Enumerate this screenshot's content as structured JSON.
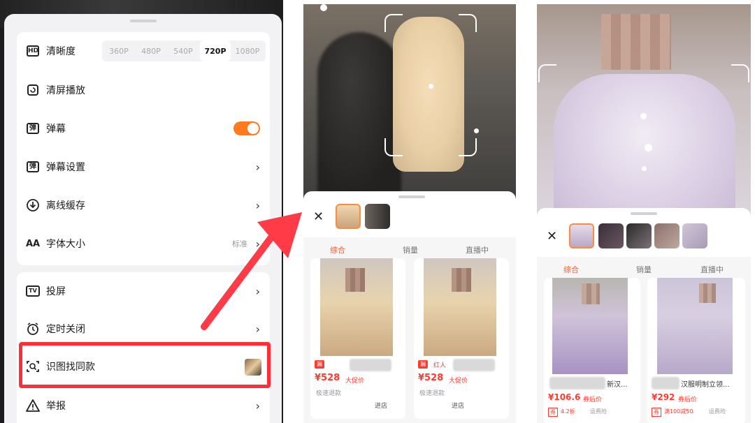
{
  "settings": {
    "quality": {
      "label": "清晰度",
      "options": [
        "360P",
        "480P",
        "540P",
        "720P",
        "1080P"
      ],
      "selected": "720P"
    },
    "items": [
      {
        "label": "清屏播放"
      },
      {
        "label": "弹幕",
        "toggle": true
      },
      {
        "label": "弹幕设置"
      },
      {
        "label": "离线缓存"
      },
      {
        "label": "字体大小",
        "value": "标准"
      }
    ],
    "items2": [
      {
        "label": "投屏"
      },
      {
        "label": "定时关闭"
      },
      {
        "label": "识图找同款"
      },
      {
        "label": "举报"
      }
    ],
    "icon_glyphs": {
      "hd": "HD",
      "danmaku": "弹",
      "tv": "TV",
      "font": "AA"
    }
  },
  "result_left": {
    "tabs": [
      "综合",
      "销量",
      "直播中"
    ],
    "products": [
      {
        "tag": "漏",
        "price": "¥528",
        "price_note": "大促价",
        "note": "极速退款",
        "store": "进店"
      },
      {
        "tag": "漏",
        "tag2": "红人",
        "price": "¥528",
        "price_note": "大促价",
        "note": "极速退款",
        "store": "进店"
      }
    ]
  },
  "result_right": {
    "tabs": [
      "综合",
      "销量",
      "直播中"
    ],
    "products": [
      {
        "title_tail": "新汉...",
        "price": "¥106.6",
        "price_note": "券后价",
        "badge": "券",
        "badge_note": "4.2折",
        "extra": "运费险"
      },
      {
        "title_tail": "汉服明制立领...",
        "price": "¥292",
        "price_note": "券后价",
        "badge": "券",
        "badge_note": "满100减50",
        "extra": "运费险"
      }
    ]
  },
  "accent": "#ff7a1a",
  "highlight": "#ff2d3a"
}
